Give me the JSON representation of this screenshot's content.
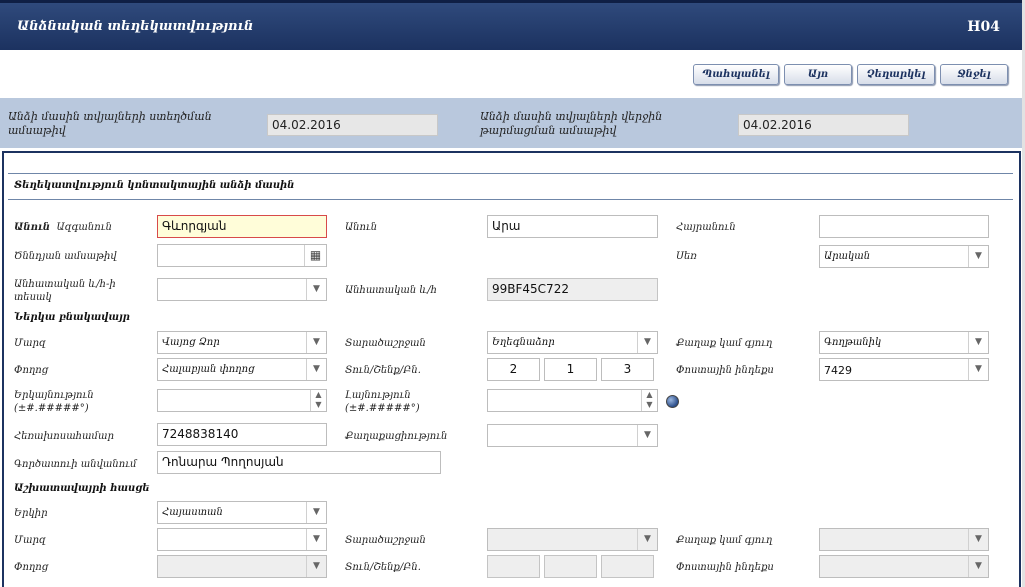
{
  "header": {
    "title": "Անձնական տեղեկատվություն",
    "code": "H04"
  },
  "toolbar": {
    "print_label": "Պահպանել",
    "new_label": "Այո",
    "cancel_label": "Չեղարկել",
    "delete_label": "Ջնջել"
  },
  "info": {
    "created_label": "Անձի մասին տվյալների ստեղծման ամսաթիվ",
    "created_value": "04.02.2016",
    "updated_label": "Անձի մասին տվյալների վերջին թարմացման ամսաթիվ",
    "updated_value": "04.02.2016"
  },
  "personal": {
    "section_title": "Տեղեկատվություն կոնտակտային անձի մասին",
    "name_prefix": "Անուն",
    "surname_label": "Ազգանուն",
    "surname_value": "Գևորգյան",
    "firstname_label": "Անուն",
    "firstname_value": "Արա",
    "patronymic_label": "Հայրանուն",
    "patronymic_value": "",
    "birthdate_label": "Ծննդյան ամսաթիվ",
    "birthdate_value": "",
    "gender_label": "Սեռ",
    "gender_value": "Արական",
    "idtype_label": "Անհատական և/հ-ի տեսակ",
    "idtype_value": "",
    "idnum_label": "Անհատական և/հ",
    "idnum_value": "99BF45C722"
  },
  "residence": {
    "section_title": "Ներկա բնակավայր",
    "region_label": "Մարզ",
    "region_value": "Վայոց Ձոր",
    "community_label": "Տարածաշրջան",
    "community_value": "Եղեգնաձոր",
    "city_label": "Քաղաք կամ գյուղ",
    "city_value": "Գողթանիկ",
    "street_label": "Փողոց",
    "street_value": "Հալաբյան փողոց",
    "house_label": "Տուն/Շենք/Բն.",
    "house_values": [
      "2",
      "1",
      "3"
    ],
    "postal_label": "Փոստային ինդեքս",
    "postal_value": "7429",
    "longitude_label": "Երկայնություն (±#.#####°)",
    "longitude_value": "",
    "latitude_label": "Լայնություն (±#.#####°)",
    "latitude_value": "",
    "phone_label": "Հեռախոսահամար",
    "phone_value": "7248838140",
    "citizenship_label": "Քաղաքացիություն",
    "citizenship_value": "",
    "employer_label": "Գործատուի անվանում",
    "employer_value": "Դոնարա Պողոսյան"
  },
  "workplace": {
    "section_title": "Աշխատավայրի հասցե",
    "country_label": "Երկիր",
    "country_value": "Հայաստան",
    "region_label": "Մարզ",
    "region_value": "",
    "community_label": "Տարածաշրջան",
    "community_value": "",
    "city_label": "Քաղաք կամ գյուղ",
    "city_value": "",
    "street_label": "Փողոց",
    "street_value": "",
    "house_label": "Տուն/Շենք/Բն.",
    "postal_label": "Փոստային ինդեքս",
    "postal_value": ""
  },
  "icons": {
    "dropdown": "chevron-down-icon",
    "calendar": "calendar-icon",
    "spinner": "spinner-arrows-icon",
    "globe": "globe-icon"
  }
}
